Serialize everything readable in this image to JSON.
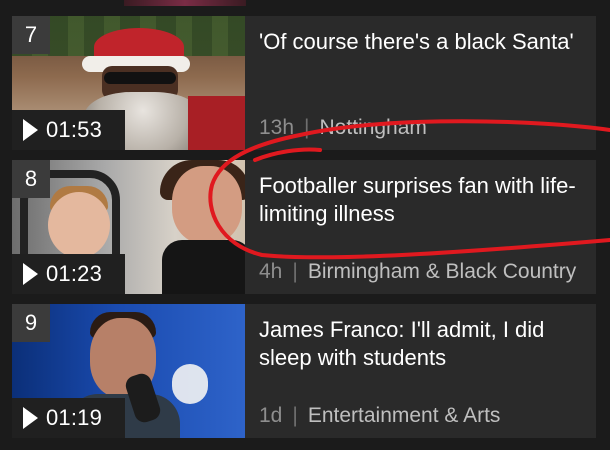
{
  "videos": [
    {
      "rank": "7",
      "title": "'Of course there's a black Santa'",
      "duration": "01:53",
      "age": "13h",
      "region": "Nottingham",
      "thumbnail": "santa-thumbnail"
    },
    {
      "rank": "8",
      "title": "Footballer surprises fan with life-limiting illness",
      "duration": "01:23",
      "age": "4h",
      "region": "Birmingham & Black Country",
      "thumbnail": "footballer-thumbnail"
    },
    {
      "rank": "9",
      "title": "James Franco: I'll admit, I did sleep with students",
      "duration": "01:19",
      "age": "1d",
      "region": "Entertainment & Arts",
      "thumbnail": "franco-thumbnail"
    }
  ],
  "separator": "|",
  "colors": {
    "background": "#1b1b1b",
    "card": "#2a2a2a",
    "badge": "#3b3b3b",
    "meta_text": "#8e8e8e",
    "annotation": "#e0191f"
  },
  "icons": {
    "play": "play-icon"
  }
}
